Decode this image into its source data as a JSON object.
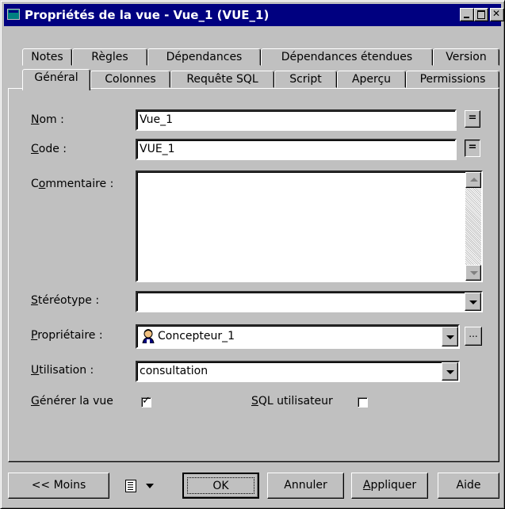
{
  "window": {
    "title": "Propriétés de la vue - Vue_1 (VUE_1)",
    "titlebar_color": "#000080",
    "face_color": "#c0c0c0"
  },
  "tabs_back": [
    "Notes",
    "Règles",
    "Dépendances",
    "Dépendances étendues",
    "Version"
  ],
  "tabs_front": [
    "Général",
    "Colonnes",
    "Requête SQL",
    "Script",
    "Aperçu",
    "Permissions"
  ],
  "active_tab": "Général",
  "form": {
    "nom": {
      "label_u": "N",
      "label_rest": "om :",
      "value": "Vue_1"
    },
    "code": {
      "label_u": "C",
      "label_rest": "ode :",
      "value": "VUE_1"
    },
    "equals_button": "=",
    "commentaire": {
      "label_pre": "C",
      "label_u": "o",
      "label_rest": "mmentaire :",
      "value": ""
    },
    "stereotype": {
      "label_u": "S",
      "label_rest": "téréotype :",
      "value": ""
    },
    "proprietaire": {
      "label_u": "P",
      "label_rest": "ropriétaire :",
      "value": "Concepteur_1",
      "icon": "user-icon"
    },
    "browse_button": "...",
    "utilisation": {
      "label_u": "U",
      "label_rest": "tilisation :",
      "value": "consultation"
    },
    "generer": {
      "label_u": "G",
      "label_rest": "énérer la vue",
      "checked": true
    },
    "sql_user": {
      "label_u": "S",
      "label_rest": "QL utilisateur",
      "checked": false
    }
  },
  "footer": {
    "moins": "<< Moins",
    "ok": "OK",
    "annuler": "Annuler",
    "appliquer_u": "A",
    "appliquer_rest": "ppliquer",
    "aide": "Aide"
  }
}
